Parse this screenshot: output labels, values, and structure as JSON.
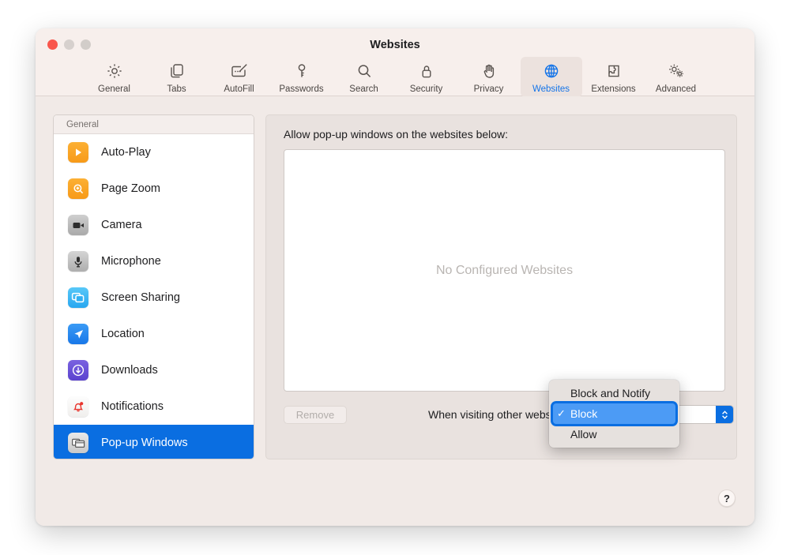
{
  "window": {
    "title": "Websites",
    "traffic_lights": [
      "close",
      "minimize",
      "zoom"
    ]
  },
  "toolbar": {
    "items": [
      {
        "label": "General",
        "icon": "gear-icon",
        "selected": false
      },
      {
        "label": "Tabs",
        "icon": "tabs-icon",
        "selected": false
      },
      {
        "label": "AutoFill",
        "icon": "autofill-icon",
        "selected": false
      },
      {
        "label": "Passwords",
        "icon": "key-icon",
        "selected": false
      },
      {
        "label": "Search",
        "icon": "search-icon",
        "selected": false
      },
      {
        "label": "Security",
        "icon": "lock-icon",
        "selected": false
      },
      {
        "label": "Privacy",
        "icon": "hand-icon",
        "selected": false
      },
      {
        "label": "Websites",
        "icon": "globe-icon",
        "selected": true
      },
      {
        "label": "Extensions",
        "icon": "puzzle-icon",
        "selected": false
      },
      {
        "label": "Advanced",
        "icon": "gears-icon",
        "selected": false
      }
    ]
  },
  "sidebar": {
    "header": "General",
    "items": [
      {
        "label": "Auto-Play",
        "icon": "play-icon",
        "selected": false
      },
      {
        "label": "Page Zoom",
        "icon": "page-zoom-icon",
        "selected": false
      },
      {
        "label": "Camera",
        "icon": "camera-icon",
        "selected": false
      },
      {
        "label": "Microphone",
        "icon": "microphone-icon",
        "selected": false
      },
      {
        "label": "Screen Sharing",
        "icon": "screen-share-icon",
        "selected": false
      },
      {
        "label": "Location",
        "icon": "location-icon",
        "selected": false
      },
      {
        "label": "Downloads",
        "icon": "download-icon",
        "selected": false
      },
      {
        "label": "Notifications",
        "icon": "bell-icon",
        "selected": false
      },
      {
        "label": "Pop-up Windows",
        "icon": "popup-windows-icon",
        "selected": true
      }
    ]
  },
  "detail": {
    "title": "Allow pop-up windows on the websites below:",
    "empty_text": "No Configured Websites",
    "remove_label": "Remove",
    "remove_disabled": true,
    "other_websites_label": "When visiting other websites"
  },
  "dropdown": {
    "options": [
      {
        "label": "Block and Notify",
        "checked": false,
        "selected": false
      },
      {
        "label": "Block",
        "checked": true,
        "selected": true
      },
      {
        "label": "Allow",
        "checked": false,
        "selected": false
      }
    ],
    "check_glyph": "✓"
  },
  "help": {
    "glyph": "?"
  },
  "colors": {
    "accent": "#0a6ee1",
    "menu_highlight": "#4c9bf5",
    "window_chrome": "#f7efec",
    "pane_bg": "#e9e2df",
    "close_red": "#f9564c"
  }
}
